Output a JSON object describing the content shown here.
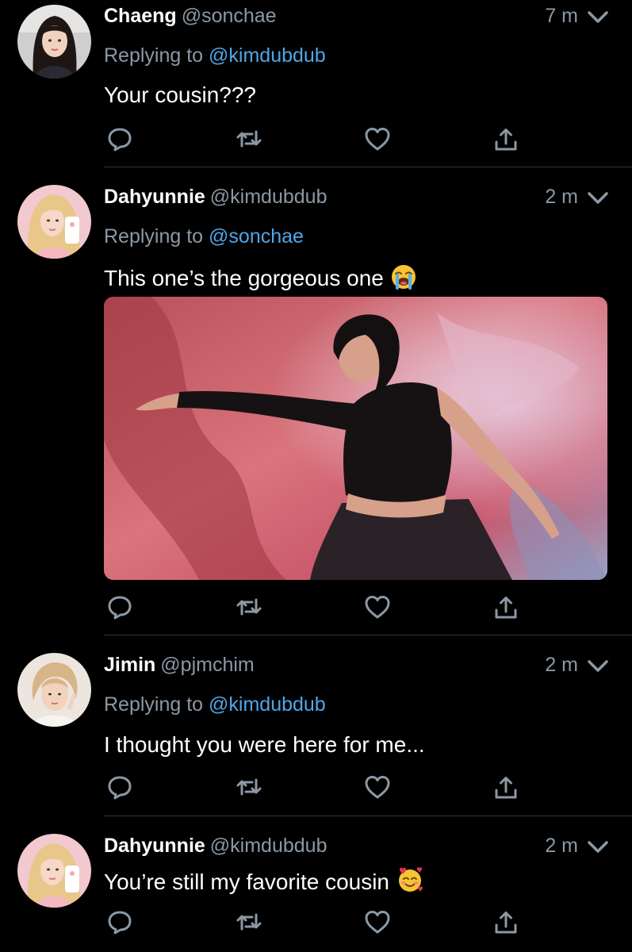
{
  "tweets": [
    {
      "name": "Chaeng",
      "handle": "@sonchae",
      "time": "7 m",
      "replying_prefix": "Replying to",
      "replying_to": "@kimdubdub",
      "text": "Your cousin???",
      "avatar_icon": "avatar-chaeng"
    },
    {
      "name": "Dahyunnie",
      "handle": "@kimdubdub",
      "time": "2 m",
      "replying_prefix": "Replying to",
      "replying_to": "@sonchae",
      "text": "This one’s the gorgeous one",
      "emoji_icon": "loudly-crying-face-emoji",
      "media_icon": "dancer-photo",
      "avatar_icon": "avatar-dahyunnie"
    },
    {
      "name": "Jimin",
      "handle": "@pjmchim",
      "time": "2 m",
      "replying_prefix": "Replying to",
      "replying_to": "@kimdubdub",
      "text": "I thought you were here for me...",
      "avatar_icon": "avatar-jimin"
    },
    {
      "name": "Dahyunnie",
      "handle": "@kimdubdub",
      "time": "2 m",
      "text": "You’re still my favorite cousin",
      "emoji_icon": "smiling-face-with-hearts-emoji",
      "avatar_icon": "avatar-dahyunnie"
    }
  ],
  "action_icons": [
    "reply-icon",
    "retweet-icon",
    "like-icon",
    "share-icon"
  ],
  "colors": {
    "background": "#000000",
    "text": "#ffffff",
    "secondary": "#8b98a5",
    "mention": "#4fa6e8",
    "divider": "#2f3336"
  }
}
